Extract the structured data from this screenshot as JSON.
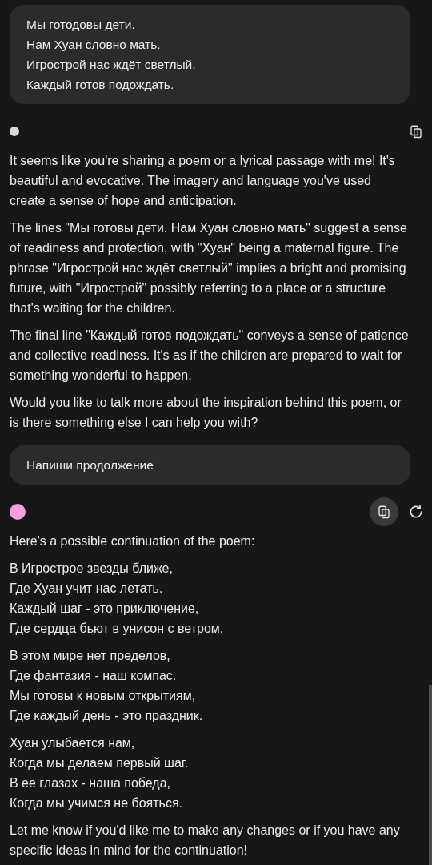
{
  "messages": [
    {
      "kind": "user",
      "lines": [
        "Мы готодовы дети.",
        "Нам Хуан словно мать.",
        "Игрострой нас ждёт светлый.",
        "Каждый готов подождать."
      ]
    },
    {
      "kind": "bot",
      "avatar": {
        "color": "#d9d9d9",
        "large": false
      },
      "actions": [
        {
          "kind": "copy",
          "selected": false
        }
      ],
      "paragraphs": [
        {
          "lines": [
            "It seems like you're sharing a poem or a lyrical passage with me! It's beautiful and evocative. The imagery and language you've used create a sense of hope and anticipation."
          ]
        },
        {
          "lines": [
            "The lines \"Мы готовы дети. Нам Хуан словно мать\" suggest a sense of readiness and protection, with \"Хуан\" being a maternal figure. The phrase \"Игрострой нас ждёт светлый\" implies a bright and promising future, with \"Игрострой\" possibly referring to a place or a structure that's waiting for the children."
          ]
        },
        {
          "lines": [
            "The final line \"Каждый готов подождать\" conveys a sense of patience and collective readiness. It's as if the children are prepared to wait for something wonderful to happen."
          ]
        },
        {
          "lines": [
            "Would you like to talk more about the inspiration behind this poem, or is there something else I can help you with?"
          ]
        }
      ]
    },
    {
      "kind": "user",
      "lines": [
        "Напиши продолжение"
      ]
    },
    {
      "kind": "bot",
      "avatar": {
        "color": "#f59fdc",
        "large": true
      },
      "actions": [
        {
          "kind": "copy",
          "selected": true
        },
        {
          "kind": "regenerate",
          "selected": false
        }
      ],
      "paragraphs": [
        {
          "lines": [
            "Here's a possible continuation of the poem:"
          ]
        },
        {
          "lines": [
            "В Игрострое звезды ближе,",
            "Где Хуан учит нас летать.",
            "Каждый шаг - это приключение,",
            "Где сердца бьют в унисон с ветром."
          ]
        },
        {
          "lines": [
            "В этом мире нет пределов,",
            "Где фантазия - наш компас.",
            "Мы готовы к новым открытиям,",
            "Где каждый день - это праздник."
          ]
        },
        {
          "lines": [
            "Хуан улыбается нам,",
            "Когда мы делаем первый шаг.",
            "В ее глазах - наша победа,",
            "Когда мы учимся не бояться."
          ]
        },
        {
          "lines": [
            "Let me know if you'd like me to make any changes or if you have any specific ideas in mind for the continuation!"
          ]
        }
      ]
    }
  ]
}
